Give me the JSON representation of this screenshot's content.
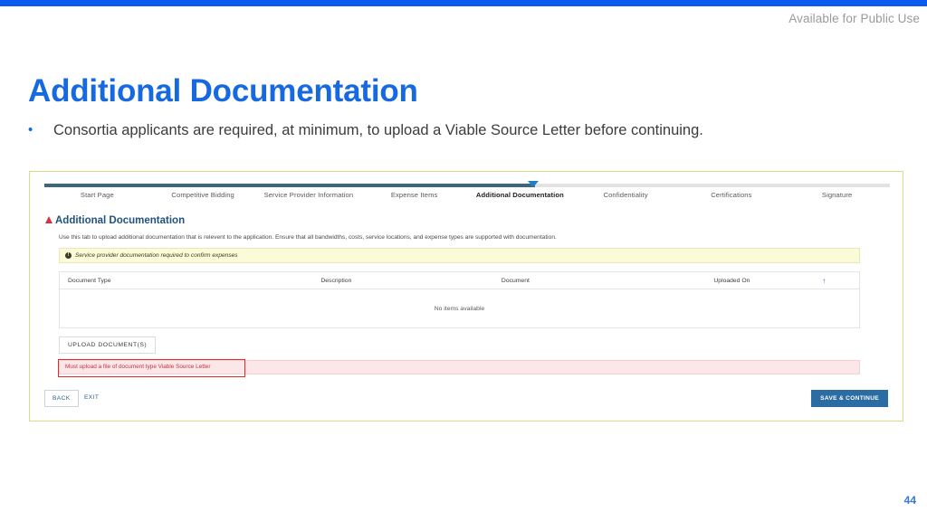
{
  "slide": {
    "public_use_label": "Available for Public Use",
    "title": "Additional Documentation",
    "bullet_marker": "•",
    "bullet_text": "Consortia applicants are required, at minimum, to upload a Viable Source Letter before continuing.",
    "page_number": "44",
    "accent_blue": "#1669e0",
    "top_bar_color": "#0b5bef",
    "panel_border_color": "#d6dd86"
  },
  "app": {
    "stepper": {
      "progress_percent": 58,
      "fill_color": "#3c6781",
      "track_color": "#e3e3e3",
      "marker_color": "#1f7fc4",
      "steps": [
        {
          "label": "Start Page",
          "active": false
        },
        {
          "label": "Competitive Bidding",
          "active": false
        },
        {
          "label": "Service Provider Information",
          "active": false
        },
        {
          "label": "Expense Items",
          "active": false
        },
        {
          "label": "Additional Documentation",
          "active": true
        },
        {
          "label": "Confidentiality",
          "active": false
        },
        {
          "label": "Certifications",
          "active": false
        },
        {
          "label": "Signature",
          "active": false
        }
      ]
    },
    "section": {
      "title": "Additional Documentation",
      "warning_icon": "warning-triangle-icon",
      "title_color": "#22527d",
      "description": "Use this tab to upload additional documentation that is relevent to the application. Ensure that all bandwidths, costs, service locations, and expense types are supported with documentation."
    },
    "notice": {
      "icon": "info-circle-icon",
      "icon_glyph": "!",
      "text": "Service provider documentation required to confirm expenses",
      "background": "#fbfbd8"
    },
    "table": {
      "columns": [
        "Document Type",
        "Description",
        "Document",
        "Uploaded On"
      ],
      "sort_indicator": "↑",
      "rows": [],
      "empty_message": "No items available"
    },
    "upload_button_label": "UPLOAD DOCUMENT(S)",
    "error": {
      "message": "Must upload a file of document type Viable Source Letter",
      "background": "#fbe6e8",
      "text_color": "#c8323f",
      "highlight_color": "#e02b2b"
    },
    "footer": {
      "back_label": "BACK",
      "exit_label": "EXIT",
      "save_label": "SAVE & CONTINUE",
      "save_color": "#2b6ca3"
    }
  }
}
